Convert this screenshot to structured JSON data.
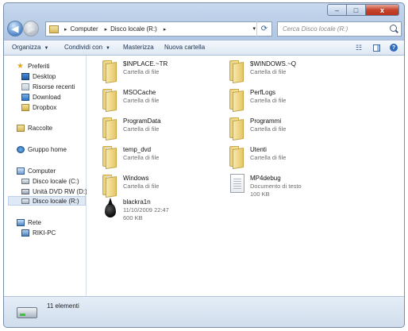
{
  "window": {
    "caption": {
      "minimize": "–",
      "maximize": "□",
      "close": "x"
    }
  },
  "address_bar": {
    "crumbs": [
      "Computer",
      "Disco locale (R:)"
    ],
    "separator": "▸",
    "dropdown": "▾",
    "refresh": "⟳"
  },
  "search": {
    "placeholder": "Cerca Disco locale (R:)"
  },
  "toolbar": {
    "organize": "Organizza",
    "share": "Condividi con",
    "burn": "Masterizza",
    "new_folder": "Nuova cartella",
    "dropdown_arrow": "▼",
    "help": "?"
  },
  "nav_pane": {
    "favorites": "Preferiti",
    "desktop": "Desktop",
    "recent": "Risorse recenti",
    "downloads": "Download",
    "dropbox": "Dropbox",
    "libraries": "Raccolte",
    "homegroup": "Gruppo home",
    "computer": "Computer",
    "drive_c": "Disco locale (C:)",
    "drive_d": "Unità DVD RW (D:) N",
    "drive_r": "Disco locale (R:)",
    "network": "Rete",
    "riki_pc": "RIKI-PC"
  },
  "items": [
    {
      "name": "$INPLACE.~TR",
      "type": "Cartella di file",
      "icon": "folder-icon"
    },
    {
      "name": "$WINDOWS.~Q",
      "type": "Cartella di file",
      "icon": "folder-icon"
    },
    {
      "name": "MSOCache",
      "type": "Cartella di file",
      "icon": "folder-icon"
    },
    {
      "name": "PerfLogs",
      "type": "Cartella di file",
      "icon": "folder-icon"
    },
    {
      "name": "ProgramData",
      "type": "Cartella di file",
      "icon": "folder-icon"
    },
    {
      "name": "Programmi",
      "type": "Cartella di file",
      "icon": "folder-icon"
    },
    {
      "name": "temp_dvd",
      "type": "Cartella di file",
      "icon": "folder-icon"
    },
    {
      "name": "Utenti",
      "type": "Cartella di file",
      "icon": "folder-icon"
    },
    {
      "name": "Windows",
      "type": "Cartella di file",
      "icon": "folder-icon"
    },
    {
      "name": "MP4debug",
      "type": "Documento di testo",
      "size": "100 KB",
      "icon": "text-file-icon"
    },
    {
      "name": "blackra1n",
      "type": "11/10/2009 22:47",
      "size": "600 KB",
      "icon": "black-drop-icon"
    }
  ],
  "status": {
    "count": "11 elementi"
  }
}
